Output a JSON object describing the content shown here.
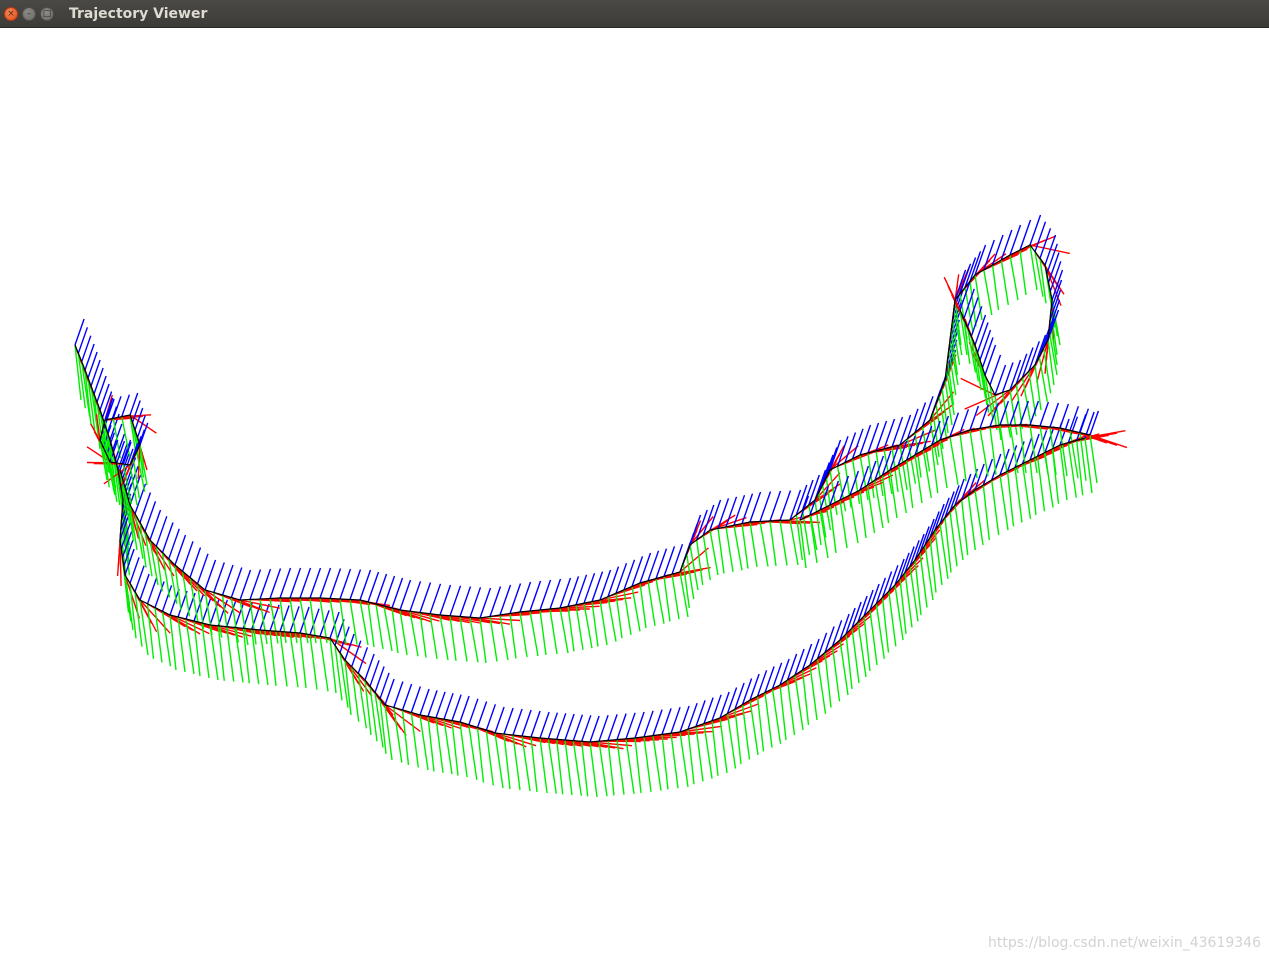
{
  "window": {
    "title": "Trajectory Viewer",
    "buttons": {
      "close": "close-icon",
      "minimize": "minimize-icon",
      "maximize": "maximize-icon"
    }
  },
  "legend_colors": {
    "trajectory": "#000000",
    "x_axis": "#ff0000",
    "y_axis": "#00ee00",
    "z_axis": "#0000ff"
  },
  "watermark": "https://blog.csdn.net/weixin_43619346"
}
